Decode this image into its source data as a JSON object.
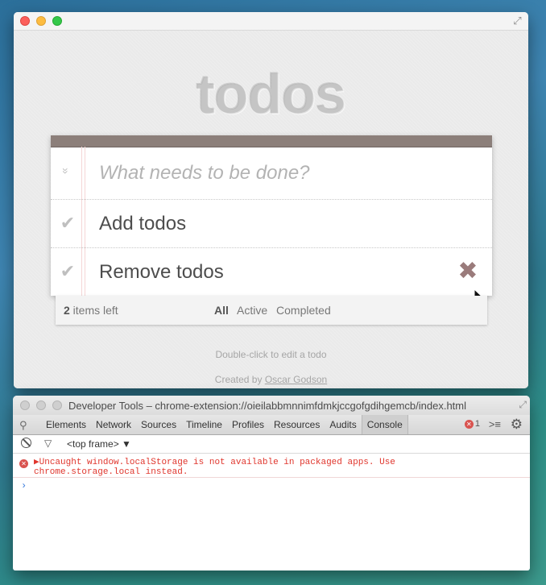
{
  "app": {
    "title": "todos",
    "new_todo_placeholder": "What needs to be done?",
    "toggle_all_icon": "»",
    "todos": [
      {
        "label": "Add todos",
        "completed": false
      },
      {
        "label": "Remove todos",
        "completed": false
      }
    ],
    "check_icon": "✔",
    "destroy_icon": "✖",
    "footer": {
      "count": "2",
      "count_suffix": " items left",
      "filters": [
        "All",
        "Active",
        "Completed"
      ],
      "selected_filter": "All"
    },
    "hint": "Double-click to edit a todo",
    "credit_prefix": "Created by ",
    "credit_author": "Oscar Godson"
  },
  "devtools": {
    "title": "Developer Tools – chrome-extension://oieilabbmnnimfdmkjccgofgdihgemcb/index.html",
    "tabs": [
      "Elements",
      "Network",
      "Sources",
      "Timeline",
      "Profiles",
      "Resources",
      "Audits",
      "Console"
    ],
    "active_tab": "Console",
    "error_count": "1",
    "frame_selector": "<top frame> ▼",
    "console_error": "Uncaught window.localStorage is not available in packaged apps. Use\nchrome.storage.local instead.",
    "prompt": "›"
  },
  "colors": {
    "header_bar": "#8c7f7a",
    "error_text": "#e0362d",
    "title_text": "#d6d6d6"
  }
}
